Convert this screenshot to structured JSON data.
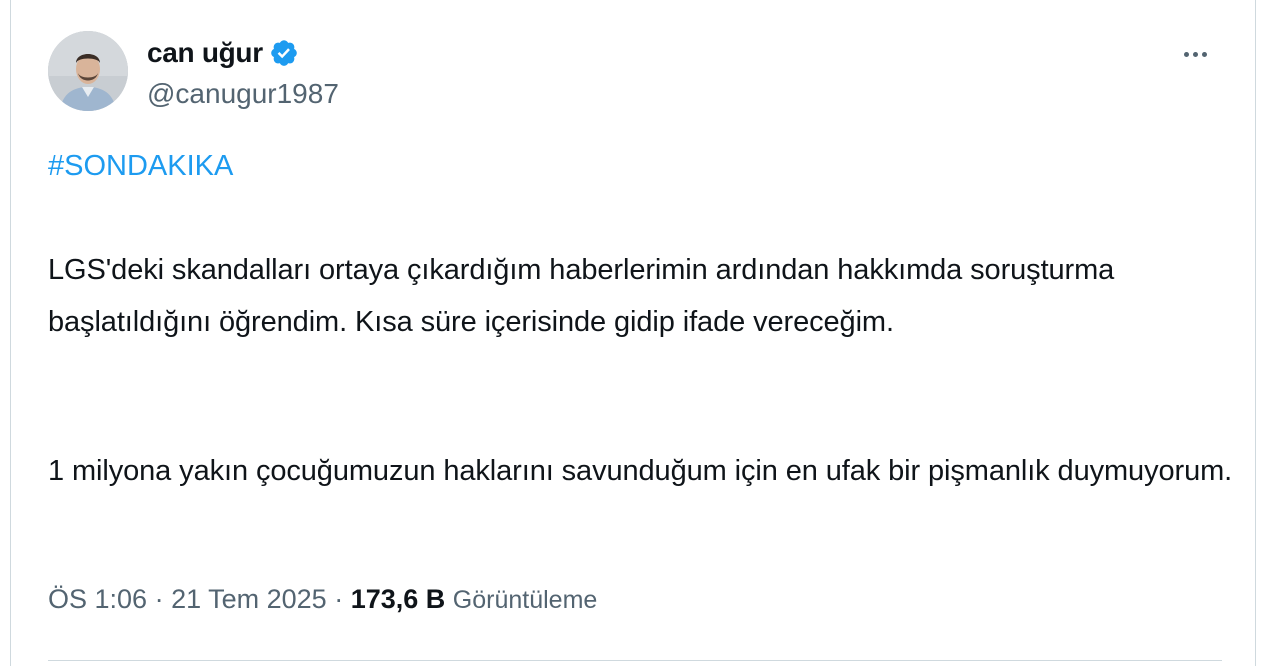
{
  "author": {
    "display_name": "can uğur",
    "handle": "@canugur1987",
    "verified": true
  },
  "tweet": {
    "hashtag": "#SONDAKIKA",
    "paragraph1": "LGS'deki skandalları ortaya çıkardığım haberlerimin ardından hakkımda soruşturma başlatıldığını öğrendim. Kısa süre içerisinde gidip ifade vereceğim.",
    "paragraph2": "1 milyona yakın çocuğumuzun haklarını savunduğum için en ufak bir pişmanlık duymuyorum."
  },
  "meta": {
    "time": "ÖS 1:06",
    "separator1": " · ",
    "date": "21 Tem 2025",
    "separator2": " · ",
    "views_count": "173,6 B",
    "views_label": "Görüntüleme"
  },
  "icons": {
    "verified": "verified-badge-icon",
    "more": "more-horizontal-icon"
  },
  "colors": {
    "accent": "#1d9bf0",
    "secondary_text": "#536471",
    "primary_text": "#0f1419",
    "border": "#cfd9de"
  }
}
